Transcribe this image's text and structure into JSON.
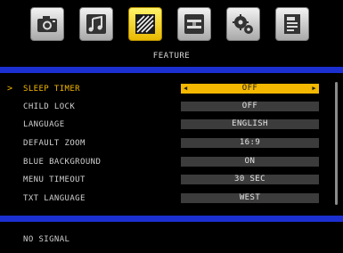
{
  "tabs": [
    {
      "name": "picture",
      "icon": "camera-icon",
      "active": false
    },
    {
      "name": "sound",
      "icon": "music-note-icon",
      "active": false
    },
    {
      "name": "feature",
      "icon": "feature-stripes-icon",
      "active": true
    },
    {
      "name": "connection",
      "icon": "cable-icon",
      "active": false
    },
    {
      "name": "setup",
      "icon": "gears-icon",
      "active": false
    },
    {
      "name": "guide",
      "icon": "document-icon",
      "active": false
    }
  ],
  "section_title": "FEATURE",
  "rows": [
    {
      "label": "SLEEP TIMER",
      "value": "OFF",
      "selected": true
    },
    {
      "label": "CHILD LOCK",
      "value": "OFF",
      "selected": false
    },
    {
      "label": "LANGUAGE",
      "value": "ENGLISH",
      "selected": false
    },
    {
      "label": "DEFAULT ZOOM",
      "value": "16:9",
      "selected": false
    },
    {
      "label": "BLUE BACKGROUND",
      "value": "ON",
      "selected": false
    },
    {
      "label": "MENU TIMEOUT",
      "value": "30 SEC",
      "selected": false
    },
    {
      "label": "TXT LANGUAGE",
      "value": "WEST",
      "selected": false
    }
  ],
  "selection_arrow": ">",
  "value_arrows": {
    "left": "◀",
    "right": "▶"
  },
  "status": "NO SIGNAL",
  "colors": {
    "accent": "#f5b800",
    "bar": "#1c2fd0",
    "value_bg": "#3c3c3c",
    "text": "#d0d0d0"
  }
}
